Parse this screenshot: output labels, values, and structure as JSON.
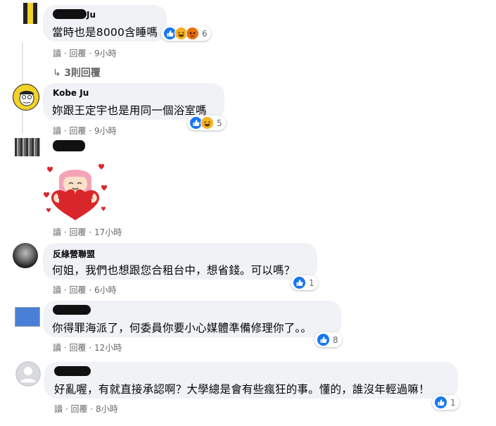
{
  "comments": [
    {
      "author": "Ju",
      "text": "當時也是8000含睡嗎",
      "reactions": {
        "icons": [
          "like-icon",
          "haha-icon",
          "angry-icon"
        ],
        "count": "6"
      },
      "actions": {
        "read": "讀",
        "reply": "回覆",
        "time": "9小時"
      },
      "view_replies": "3則回覆"
    },
    {
      "author": "Kobe Ju",
      "text": "妳跟王定宇也是用同一個浴室嗎",
      "reactions": {
        "icons": [
          "like-icon",
          "haha-icon"
        ],
        "count": "5"
      },
      "actions": {
        "read": "讀",
        "reply": "回覆",
        "time": "9小時"
      }
    },
    {
      "author": "",
      "sticker": "heart-hug-sticker",
      "actions": {
        "read": "讀",
        "reply": "回覆",
        "time": "17小時"
      }
    },
    {
      "author": "反綠營聯盟",
      "text": "何姐，我們也想跟您合租台中，想省錢。可以嗎？",
      "reactions": {
        "icons": [
          "like-icon"
        ],
        "count": "1"
      },
      "actions": {
        "read": "讀",
        "reply": "回覆",
        "time": "6小時"
      }
    },
    {
      "author": "",
      "text": "你得罪海派了，何委員你要小心媒體準備修理你了。。",
      "reactions": {
        "icons": [
          "like-icon"
        ],
        "count": "8"
      },
      "actions": {
        "read": "讀",
        "reply": "回覆",
        "time": "12小時"
      }
    },
    {
      "author": "",
      "text": "好亂喔，有就直接承認啊？大學總是會有些瘋狂的事。懂的，誰沒年輕過嘛！",
      "reactions": {
        "icons": [
          "like-icon"
        ],
        "count": "1"
      },
      "actions": {
        "read": "讀",
        "reply": "回覆",
        "time": "8小時"
      }
    }
  ],
  "separator": "·",
  "colors": {
    "bubble": "#f0f2f5",
    "meta": "#65676b",
    "like": "#1877f2",
    "haha": "#f7b125",
    "angry": "#e9710f"
  }
}
